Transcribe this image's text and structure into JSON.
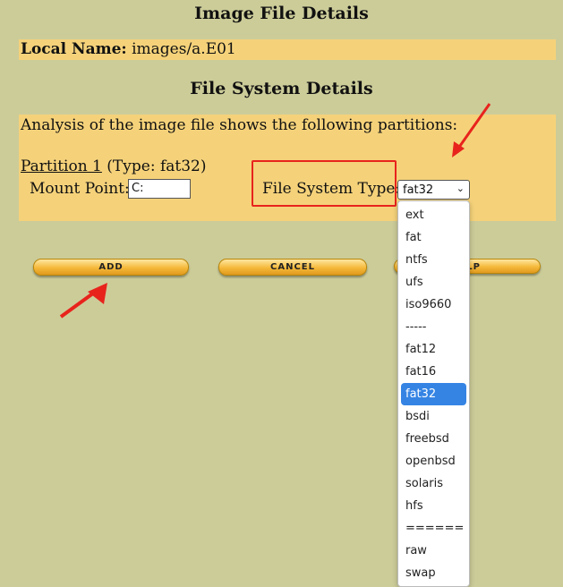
{
  "image_details": {
    "heading": "Image File Details",
    "local_name_label": "Local Name:",
    "local_name_value": "images/a.E01"
  },
  "fs_details": {
    "heading": "File System Details",
    "analysis_text": "Analysis of the image file shows the following partitions:",
    "partition_name": "Partition 1",
    "partition_type": "(Type: fat32)",
    "mount_point_label": "Mount Point:",
    "mount_point_value": "C:",
    "fs_type_label": "File System Type:",
    "fs_type_selected": "fat32"
  },
  "buttons": {
    "add": "ADD",
    "cancel": "CANCEL",
    "help_visible_fragment": "LP"
  },
  "dropdown": {
    "options": [
      "ext",
      "fat",
      "ntfs",
      "ufs",
      "iso9660",
      "-----",
      "fat12",
      "fat16",
      "fat32",
      "bsdi",
      "freebsd",
      "openbsd",
      "solaris",
      "hfs",
      "======",
      "raw",
      "swap"
    ],
    "selected": "fat32"
  },
  "colors": {
    "background": "#cccc99",
    "panel": "#f5d27a",
    "annotation_red": "#e8231c",
    "selection_blue": "#3584e4"
  }
}
